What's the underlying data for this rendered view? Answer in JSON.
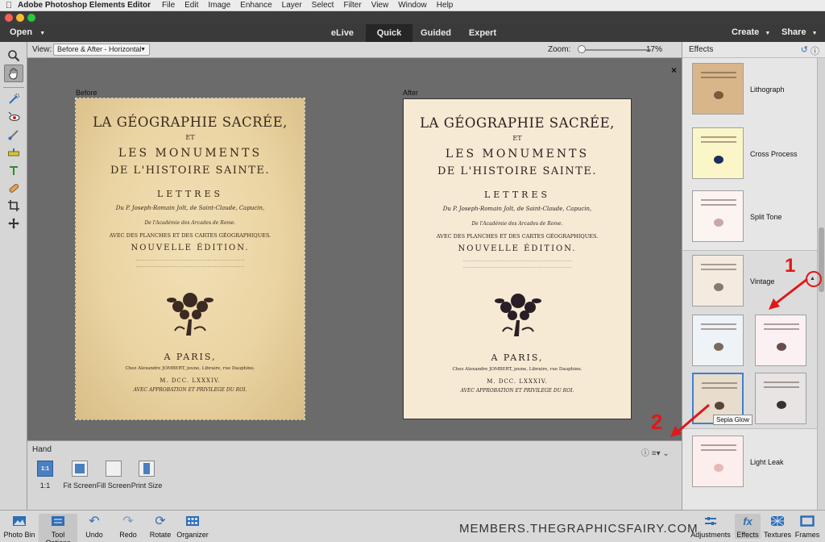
{
  "menubar": {
    "app_name": "Adobe Photoshop Elements Editor",
    "items": [
      "File",
      "Edit",
      "Image",
      "Enhance",
      "Layer",
      "Select",
      "Filter",
      "View",
      "Window",
      "Help"
    ]
  },
  "modebar": {
    "open_label": "Open",
    "tabs": [
      {
        "label": "eLive",
        "active": false
      },
      {
        "label": "Quick",
        "active": true
      },
      {
        "label": "Guided",
        "active": false
      },
      {
        "label": "Expert",
        "active": false
      }
    ],
    "create_label": "Create",
    "share_label": "Share"
  },
  "viewbar": {
    "view_label": "View:",
    "view_value": "Before & After - Horizontal",
    "zoom_label": "Zoom:",
    "zoom_value": "17%",
    "zoom_fraction": 0.04
  },
  "canvas": {
    "before_label": "Before",
    "after_label": "After",
    "close_glyph": "×",
    "document_lines": [
      "LA GÉOGRAPHIE SACRÉE,",
      "ET",
      "LES MONUMENTS",
      "DE L'HISTOIRE SAINTE.",
      "LETTRES",
      "Du P. Joseph-Romain Jolt, de Saint-Claude, Capucin,",
      "De l'Académie des Arcades de Rome.",
      "AVEC DES PLANCHES ET DES CARTES GÉOGRAPHIQUES.",
      "NOUVELLE ÉDITION.",
      "A PARIS,",
      "Chez Alexandre JOMBERT, jeune, Libraire, rue Dauphine.",
      "M. DCC. LXXXIV.",
      "AVEC APPROBATION ET PRIVILEGE DU ROI."
    ]
  },
  "tool_options": {
    "title": "Hand",
    "buttons": [
      {
        "label": "1:1",
        "icon_text": "1:1"
      },
      {
        "label": "Fit Screen"
      },
      {
        "label": "Fill Screen"
      },
      {
        "label": "Print Size"
      }
    ]
  },
  "effects": {
    "title": "Effects",
    "items": [
      {
        "label": "Lithograph"
      },
      {
        "label": "Cross Process"
      },
      {
        "label": "Split Tone"
      },
      {
        "label": "Vintage"
      },
      {
        "label": "Light Leak"
      }
    ],
    "tooltip": "Sepia Glow"
  },
  "annotations": {
    "one": "1",
    "two": "2"
  },
  "bottombar": {
    "left": [
      "Photo Bin",
      "Tool Options",
      "Undo",
      "Redo",
      "Rotate",
      "Organizer"
    ],
    "right": [
      "Adjustments",
      "Effects",
      "Textures",
      "Frames"
    ],
    "watermark": "MEMBERS.THEGRAPHICSFAIRY.COM"
  },
  "colors": {
    "accent_blue": "#4a7fc0",
    "annotation_red": "#e01818",
    "before_paper": "#ead4a2",
    "after_paper": "#f6ead4"
  }
}
